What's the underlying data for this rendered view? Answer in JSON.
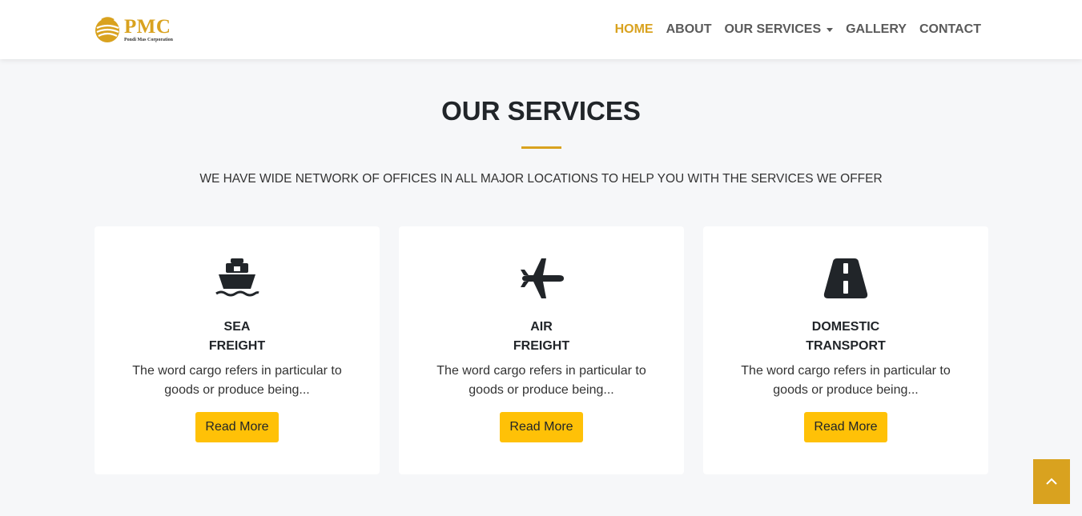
{
  "brand": {
    "name": "PMC",
    "subtitle": "Pondi Mas Corporation",
    "color": "#d9a21f"
  },
  "nav": {
    "items": [
      {
        "label": "HOME",
        "active": true
      },
      {
        "label": "ABOUT",
        "active": false
      },
      {
        "label": "OUR SERVICES",
        "active": false,
        "dropdown": true
      },
      {
        "label": "GALLERY",
        "active": false
      },
      {
        "label": "CONTACT",
        "active": false
      }
    ]
  },
  "section": {
    "title": "OUR SERVICES",
    "subtitle": "WE HAVE WIDE NETWORK OF OFFICES IN ALL MAJOR LOCATIONS TO HELP YOU WITH THE SERVICES WE OFFER"
  },
  "services": [
    {
      "icon": "ship-icon",
      "title_line1": "SEA",
      "title_line2": "FREIGHT",
      "text": "The word cargo refers in particular to goods or produce being...",
      "button": "Read More"
    },
    {
      "icon": "plane-icon",
      "title_line1": "AIR",
      "title_line2": "FREIGHT",
      "text": "The word cargo refers in particular to goods or produce being...",
      "button": "Read More"
    },
    {
      "icon": "road-icon",
      "title_line1": "DOMESTIC",
      "title_line2": "TRANSPORT",
      "text": "The word cargo refers in particular to goods or produce being...",
      "button": "Read More"
    }
  ],
  "colors": {
    "accent": "#d9a21f",
    "button": "#ffc107",
    "background": "#f6f7f9"
  },
  "back_to_top": {
    "icon": "chevron-up-icon"
  }
}
